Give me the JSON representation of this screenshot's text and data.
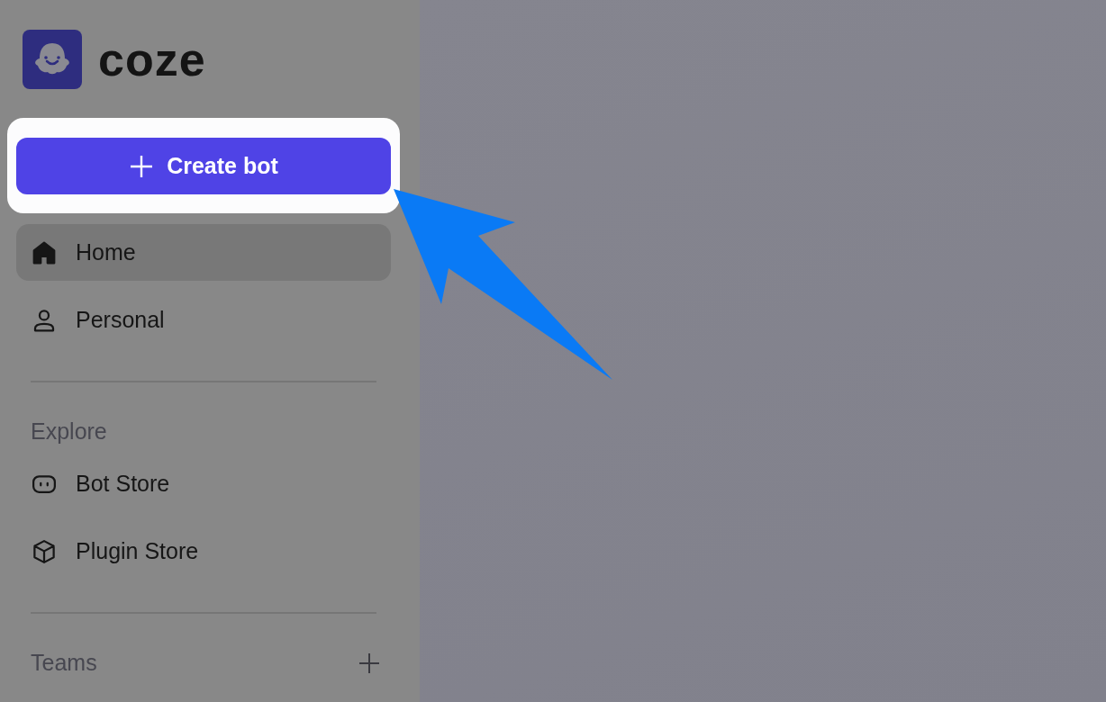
{
  "logo": {
    "text": "coze"
  },
  "create_button": {
    "label": "Create bot",
    "highlighted": true
  },
  "nav": [
    {
      "label": "Home",
      "kind": "home",
      "selected": true
    },
    {
      "label": "Personal",
      "kind": "person",
      "selected": false
    }
  ],
  "sections": [
    {
      "title": "Explore",
      "items": [
        {
          "label": "Bot Store",
          "kind": "bot",
          "selected": false
        },
        {
          "label": "Plugin Store",
          "kind": "cube",
          "selected": false
        }
      ]
    },
    {
      "title": "Teams",
      "add_button": true
    }
  ]
}
